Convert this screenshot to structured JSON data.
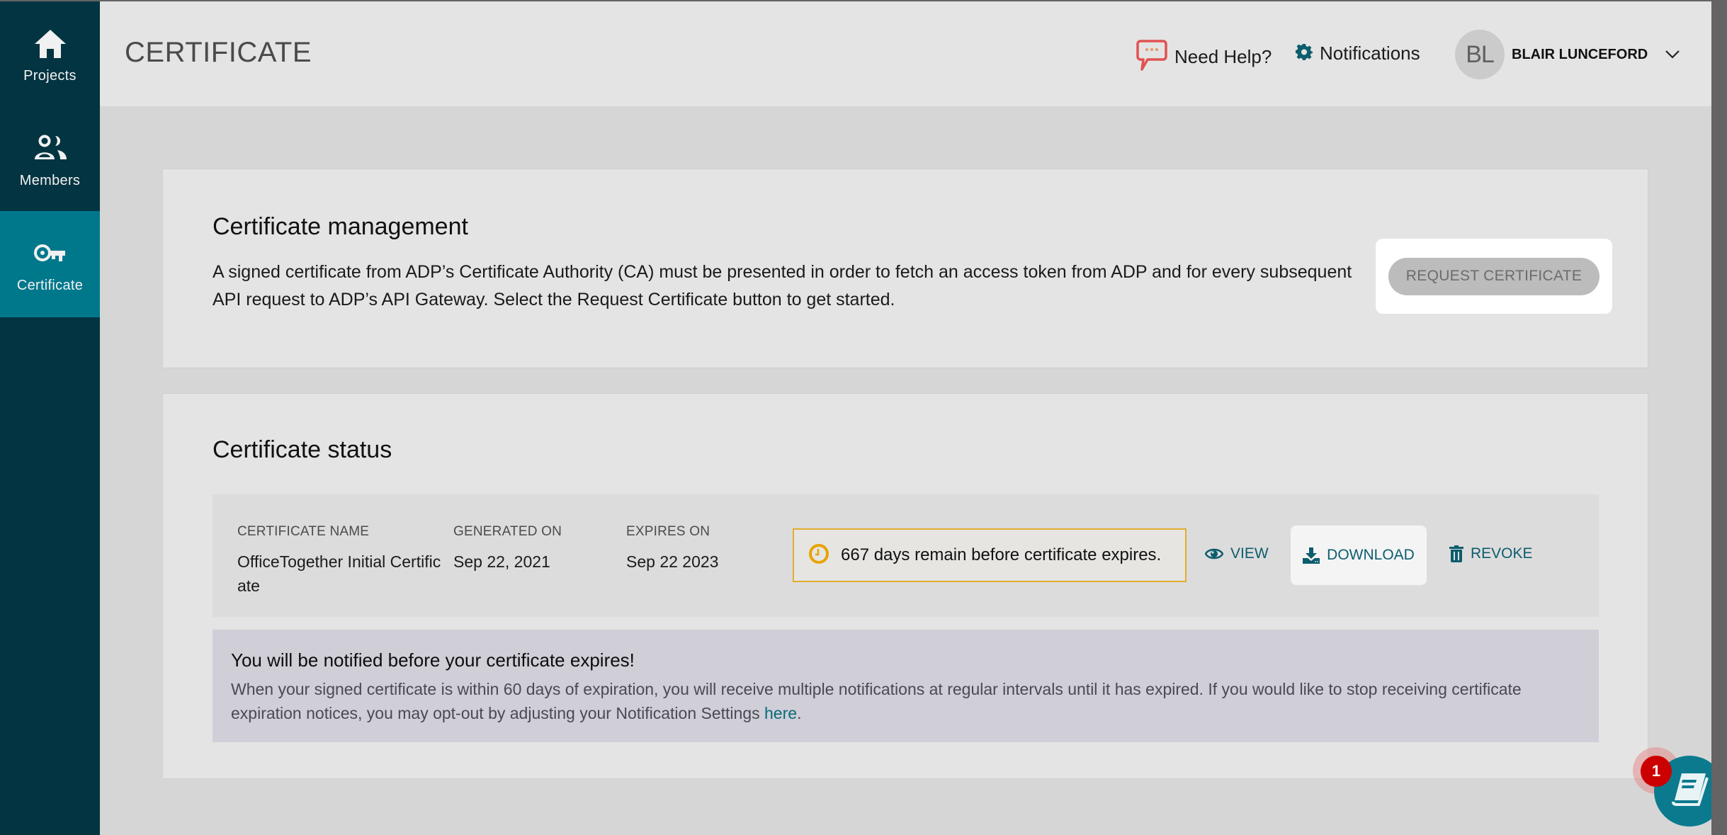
{
  "sidebar": {
    "items": [
      {
        "label": "Projects",
        "icon": "home-icon",
        "active": false
      },
      {
        "label": "Members",
        "icon": "members-icon",
        "active": false
      },
      {
        "label": "Certificate",
        "icon": "key-icon",
        "active": true
      }
    ]
  },
  "header": {
    "title": "CERTIFICATE",
    "help_label": "Need Help?",
    "notifications_label": "Notifications",
    "user_initials": "BL",
    "user_name": "BLAIR LUNCEFORD"
  },
  "management": {
    "title": "Certificate management",
    "description": "A signed certificate from ADP’s Certificate Authority (CA) must be presented in order to fetch an access token from ADP and for every subsequent API request to ADP’s API Gateway. Select the Request Certificate button to get started.",
    "request_button": "REQUEST CERTIFICATE"
  },
  "status": {
    "title": "Certificate status",
    "columns": [
      "CERTIFICATE NAME",
      "GENERATED ON",
      "EXPIRES ON"
    ],
    "certificate": {
      "name": "OfficeTogether Initial Certificate",
      "generated_on": "Sep 22, 2021",
      "expires_on": "Sep 22 2023",
      "days_remaining_text": "667 days remain before certificate expires."
    },
    "actions": {
      "view": "VIEW",
      "download": "DOWNLOAD",
      "revoke": "REVOKE"
    },
    "notice": {
      "title": "You will be notified before your certificate expires!",
      "body": "When your signed certificate is within 60 days of expiration, you will receive multiple notifications at regular intervals until it has expired. If you would like to stop receiving certificate expiration notices, you may opt-out by adjusting your Notification Settings ",
      "link": "here",
      "suffix": "."
    }
  },
  "fab": {
    "icon": "book-icon",
    "badge_count": "1"
  },
  "colors": {
    "sidebar": "#033442",
    "sidebar_active": "#00788c",
    "accent": "#0c5d6d",
    "warning_border": "#e1ad2d",
    "badge": "#cc0000"
  }
}
